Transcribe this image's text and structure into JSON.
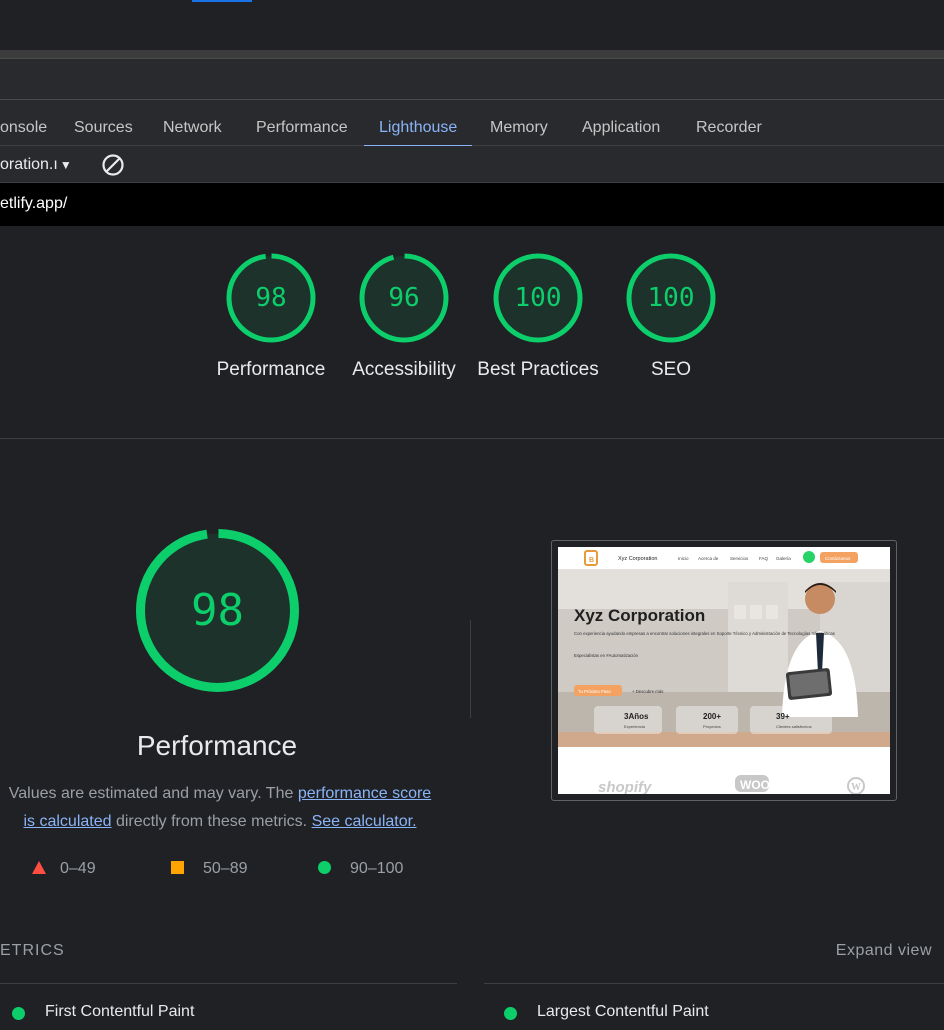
{
  "colors": {
    "pass": "#0cce6b",
    "average": "#ffa400",
    "fail": "#ff4e42",
    "accent": "#8ab4f8"
  },
  "tabs": [
    {
      "label": "onsole"
    },
    {
      "label": "Sources"
    },
    {
      "label": "Network"
    },
    {
      "label": "Performance"
    },
    {
      "label": "Lighthouse",
      "active": true
    },
    {
      "label": "Memory"
    },
    {
      "label": "Application"
    },
    {
      "label": "Recorder"
    }
  ],
  "toolbar": {
    "report_select": "oration.ı",
    "clear_icon": "clear-icon"
  },
  "url": "etlify.app/",
  "gauges": [
    {
      "score": "98",
      "score_value": 98,
      "label": "Performance"
    },
    {
      "score": "96",
      "score_value": 96,
      "label": "Accessibility"
    },
    {
      "score": "100",
      "score_value": 100,
      "label": "Best Practices"
    },
    {
      "score": "100",
      "score_value": 100,
      "label": "SEO"
    }
  ],
  "main": {
    "score": "98",
    "score_value": 98,
    "title": "Performance",
    "desc_1": "Values are estimated and may vary. The ",
    "link_score_1": "performance score",
    "link_score_2": "is calculated",
    "desc_2": " directly from these metrics. ",
    "link_calc": "See calculator."
  },
  "legend": [
    {
      "range": "0–49",
      "shape": "triangle"
    },
    {
      "range": "50–89",
      "shape": "square"
    },
    {
      "range": "90–100",
      "shape": "circle"
    }
  ],
  "thumbnail": {
    "brand": "Xyz Corporation",
    "nav": [
      "Inicio",
      "Acerca de",
      "Servicios",
      "FAQ",
      "Galería"
    ],
    "cta": "Contáctanos",
    "hero_title": "Xyz Corporation",
    "hero_text": "Con experiencia ayudando empresas a encontrar soluciones integrales en Soporte Técnico y Administración de Tecnologías Informáticas",
    "tagline": "Especialistas en #Automatización",
    "btn_primary": "Tu Próximo Paso",
    "btn_secondary": "+ Descubre más",
    "stats": [
      {
        "value": "3Años",
        "label": "Experiencia"
      },
      {
        "value": "200+",
        "label": "Proyectos"
      },
      {
        "value": "39+",
        "label": "Clientes satisfechos"
      }
    ],
    "logos": [
      "shopify",
      "WOO",
      "W"
    ]
  },
  "metrics": {
    "heading": "ETRICS",
    "expand": "Expand view",
    "items": [
      "First Contentful Paint",
      "Largest Contentful Paint"
    ]
  }
}
